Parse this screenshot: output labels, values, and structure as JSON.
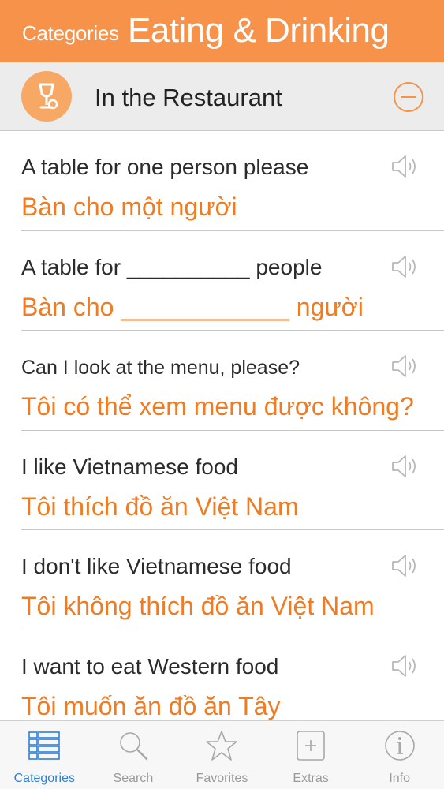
{
  "navbar": {
    "back_label": "Categories",
    "title": "Eating & Drinking"
  },
  "section": {
    "title": "In the Restaurant",
    "icon": "glass-icon",
    "collapse_icon": "minus-circle-icon"
  },
  "phrases": [
    {
      "en": "A table for one person please",
      "vi": "Bàn cho một người"
    },
    {
      "en": "A table for __________ people",
      "vi": "Bàn cho ____________ người"
    },
    {
      "en": "Can I look at the menu, please?",
      "vi": "Tôi có thể xem menu được không?"
    },
    {
      "en": "I like Vietnamese food",
      "vi": "Tôi thích đồ ăn Việt Nam"
    },
    {
      "en": "I don't like Vietnamese food",
      "vi": "Tôi không thích đồ ăn Việt Nam"
    },
    {
      "en": "I want to eat Western food",
      "vi": "Tôi muốn ăn đồ ăn Tây"
    }
  ],
  "tabs": [
    {
      "label": "Categories",
      "icon": "list-icon",
      "active": true
    },
    {
      "label": "Search",
      "icon": "search-icon",
      "active": false
    },
    {
      "label": "Favorites",
      "icon": "star-icon",
      "active": false
    },
    {
      "label": "Extras",
      "icon": "plus-box-icon",
      "active": false
    },
    {
      "label": "Info",
      "icon": "info-icon",
      "active": false
    }
  ],
  "colors": {
    "accent": "#f7924a",
    "phrase_text": "#ef7b22",
    "tab_active": "#2f7fd8"
  }
}
